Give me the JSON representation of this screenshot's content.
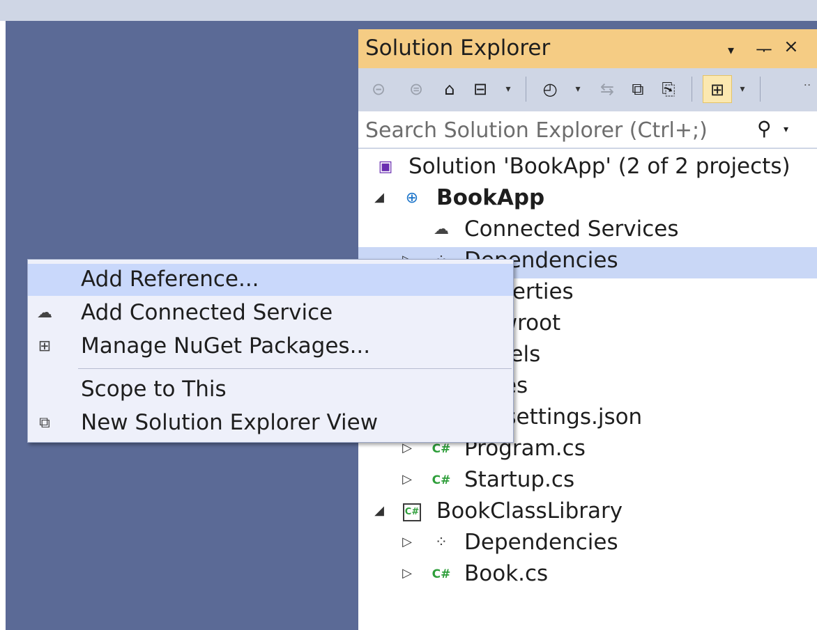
{
  "solution_explorer": {
    "title": "Solution Explorer",
    "title_buttons": {
      "dropdown_glyph": "▾",
      "pin_glyph": "ᅮ",
      "close_glyph": "×"
    },
    "toolbar": {
      "overflow_glyph": "‥",
      "buttons": [
        {
          "name": "back-button",
          "glyph": "⊝"
        },
        {
          "name": "forward-button",
          "glyph": "⊜"
        },
        {
          "name": "home-button",
          "glyph": "⌂"
        },
        {
          "name": "switch-views-button",
          "glyph": "⊟"
        },
        {
          "name": "pending-changes-filter-button",
          "glyph": "◴"
        },
        {
          "name": "sync-with-active-document-button",
          "glyph": "⇆"
        },
        {
          "name": "collapse-all-button",
          "glyph": "⧉"
        },
        {
          "name": "show-all-files-button",
          "glyph": "⎘"
        },
        {
          "name": "properties-button",
          "glyph": "⊞"
        }
      ]
    },
    "search": {
      "placeholder": "Search Solution Explorer (Ctrl+;)",
      "icon_glyph": "⚲"
    },
    "tree": [
      {
        "label": "Solution 'BookApp' (2 of 2 projects)",
        "icon": "solution-icon"
      },
      {
        "label": "BookApp",
        "icon": "web-project-icon",
        "bold": true,
        "expanded": true
      },
      {
        "label": "Connected Services",
        "icon": "connected-services-icon"
      },
      {
        "label": "Dependencies",
        "icon": "dependencies-icon",
        "selected": true
      },
      {
        "label": "Properties",
        "icon": "properties-icon"
      },
      {
        "label": "wwwroot",
        "icon": "globe-folder-icon"
      },
      {
        "label": "Models",
        "icon": "folder-icon"
      },
      {
        "label": "Pages",
        "icon": "folder-icon"
      },
      {
        "label": "appsettings.json",
        "icon": "json-file-icon"
      },
      {
        "label": "Program.cs",
        "icon": "csharp-file-icon"
      },
      {
        "label": "Startup.cs",
        "icon": "csharp-file-icon"
      },
      {
        "label": "BookClassLibrary",
        "icon": "csharp-project-icon",
        "expanded": true
      },
      {
        "label": "Dependencies",
        "icon": "dependencies-icon"
      },
      {
        "label": "Book.cs",
        "icon": "csharp-file-icon"
      }
    ]
  },
  "context_menu": {
    "items": [
      {
        "label": "Add Reference...",
        "icon": ""
      },
      {
        "label": "Add Connected Service",
        "icon": "add-connected-service-icon"
      },
      {
        "label": "Manage NuGet Packages...",
        "icon": "nuget-package-icon"
      },
      {
        "label": "Scope to This",
        "icon": ""
      },
      {
        "label": "New Solution Explorer View",
        "icon": "new-solution-explorer-view-icon"
      }
    ]
  },
  "colors": {
    "ide_background": "#5b6a96",
    "title_bar": "#f5cc84",
    "toolbar": "#cfd6e5",
    "selection": "#c9d7f6",
    "menu_background": "#eef0fa",
    "menu_hover": "#c9d8fb"
  }
}
